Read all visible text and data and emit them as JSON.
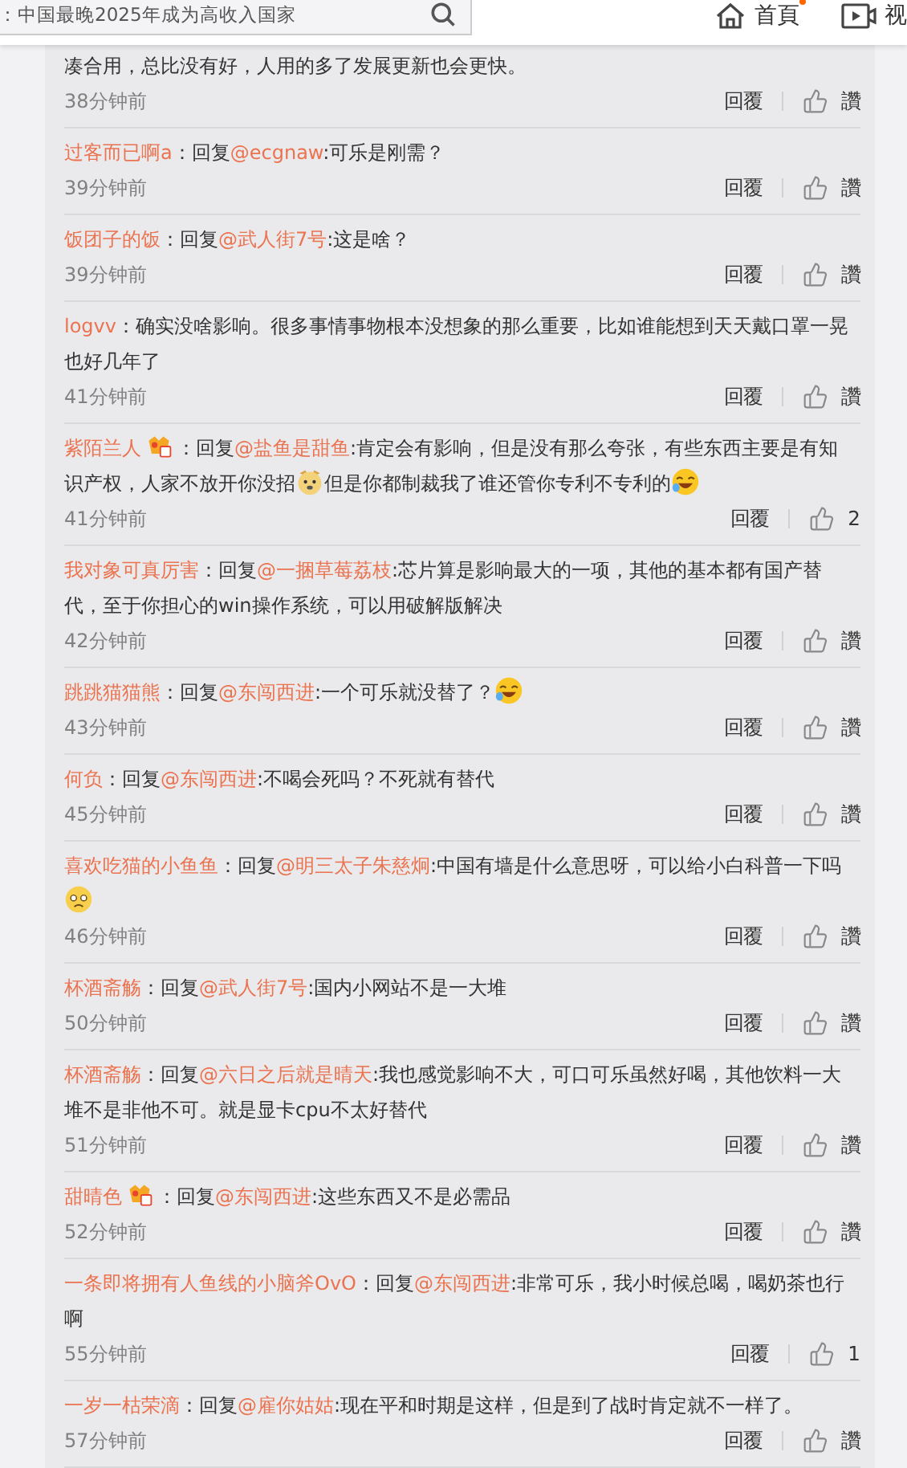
{
  "header": {
    "search_value": "：中国最晚2025年成为高收入国家",
    "nav": [
      {
        "label": "首頁",
        "kind": "home",
        "dot": true
      },
      {
        "label": "视",
        "kind": "video"
      }
    ]
  },
  "comments": [
    {
      "body": [
        {
          "kind": "text",
          "text": "凑合用，总比没有好，人用的多了发展更新也会更快。"
        }
      ],
      "time": "38分钟前",
      "reply": "回覆",
      "like": "讚"
    },
    {
      "name": "过客而已啊a",
      "sep": "：",
      "reply_prefix": "回复",
      "reply_to": "@ecgnaw",
      "body": [
        {
          "kind": "text",
          "text": ":可乐是刚需？"
        }
      ],
      "time": "39分钟前",
      "reply": "回覆",
      "like": "讚"
    },
    {
      "name": "饭团子的饭",
      "sep": "：",
      "reply_prefix": "回复",
      "reply_to": "@武人街7号",
      "body": [
        {
          "kind": "text",
          "text": ":这是啥？"
        }
      ],
      "time": "39分钟前",
      "reply": "回覆",
      "like": "讚"
    },
    {
      "name": "logvv",
      "sep": "：",
      "body": [
        {
          "kind": "text",
          "text": "确实没啥影响。很多事情事物根本没想象的那么重要，比如谁能想到天天戴口罩一晃也好几年了"
        }
      ],
      "time": "41分钟前",
      "reply": "回覆",
      "like": "讚"
    },
    {
      "name": "紫陌兰人",
      "badge": true,
      "sep": "：",
      "reply_prefix": "回复",
      "reply_to": "@盐鱼是甜鱼",
      "body": [
        {
          "kind": "text",
          "text": ":肯定会有影响，但是没有那么夸张，有些东西主要是有知识产权，人家不放开你没招"
        },
        {
          "kind": "dog_emoji"
        },
        {
          "kind": "text",
          "text": "但是你都制裁我了谁还管你专利不专利的"
        },
        {
          "kind": "laugh_emoji"
        }
      ],
      "time": "41分钟前",
      "reply": "回覆",
      "like": "2"
    },
    {
      "name": "我对象可真厉害",
      "sep": "：",
      "reply_prefix": "回复",
      "reply_to": "@一捆草莓荔枝",
      "body": [
        {
          "kind": "text",
          "text": ":芯片算是影响最大的一项，其他的基本都有国产替代，至于你担心的win操作系统，可以用破解版解决"
        }
      ],
      "time": "42分钟前",
      "reply": "回覆",
      "like": "讚"
    },
    {
      "name": "跳跳猫猫熊",
      "sep": "：",
      "reply_prefix": "回复",
      "reply_to": "@东闯西进",
      "body": [
        {
          "kind": "text",
          "text": ":一个可乐就没替了？"
        },
        {
          "kind": "laugh_emoji"
        }
      ],
      "time": "43分钟前",
      "reply": "回覆",
      "like": "讚"
    },
    {
      "name": "何负",
      "sep": "：",
      "reply_prefix": "回复",
      "reply_to": "@东闯西进",
      "body": [
        {
          "kind": "text",
          "text": ":不喝会死吗？不死就有替代"
        }
      ],
      "time": "45分钟前",
      "reply": "回覆",
      "like": "讚"
    },
    {
      "name": "喜欢吃猫的小鱼鱼",
      "sep": "：",
      "reply_prefix": "回复",
      "reply_to": "@明三太子朱慈炯",
      "body": [
        {
          "kind": "text",
          "text": ":中国有墙是什么意思呀，可以给小白科普一下吗"
        },
        {
          "kind": "sad_emoji"
        }
      ],
      "time": "46分钟前",
      "reply": "回覆",
      "like": "讚"
    },
    {
      "name": "杯酒斋觞",
      "sep": "：",
      "reply_prefix": "回复",
      "reply_to": "@武人街7号",
      "body": [
        {
          "kind": "text",
          "text": ":国内小网站不是一大堆"
        }
      ],
      "time": "50分钟前",
      "reply": "回覆",
      "like": "讚"
    },
    {
      "name": "杯酒斋觞",
      "sep": "：",
      "reply_prefix": "回复",
      "reply_to": "@六日之后就是晴天",
      "body": [
        {
          "kind": "text",
          "text": ":我也感觉影响不大，可口可乐虽然好喝，其他饮料一大堆不是非他不可。就是显卡cpu不太好替代"
        }
      ],
      "time": "51分钟前",
      "reply": "回覆",
      "like": "讚"
    },
    {
      "name": "甜晴色",
      "badge": true,
      "sep": "：",
      "reply_prefix": "回复",
      "reply_to": "@东闯西进",
      "body": [
        {
          "kind": "text",
          "text": ":这些东西又不是必需品"
        }
      ],
      "time": "52分钟前",
      "reply": "回覆",
      "like": "讚"
    },
    {
      "name": "一条即将拥有人鱼线的小脑斧OvO",
      "sep": "：",
      "reply_prefix": "回复",
      "reply_to": "@东闯西进",
      "body": [
        {
          "kind": "text",
          "text": ":非常可乐，我小时候总喝，喝奶茶也行啊"
        }
      ],
      "time": "55分钟前",
      "reply": "回覆",
      "like": "1"
    },
    {
      "name": "一岁一枯荣滴",
      "sep": "：",
      "reply_prefix": "回复",
      "reply_to": "@雇你姑姑",
      "body": [
        {
          "kind": "text",
          "text": ":现在平和时期是这样，但是到了战时肯定就不一样了。"
        }
      ],
      "time": "57分钟前",
      "reply": "回覆",
      "like": "讚"
    }
  ]
}
